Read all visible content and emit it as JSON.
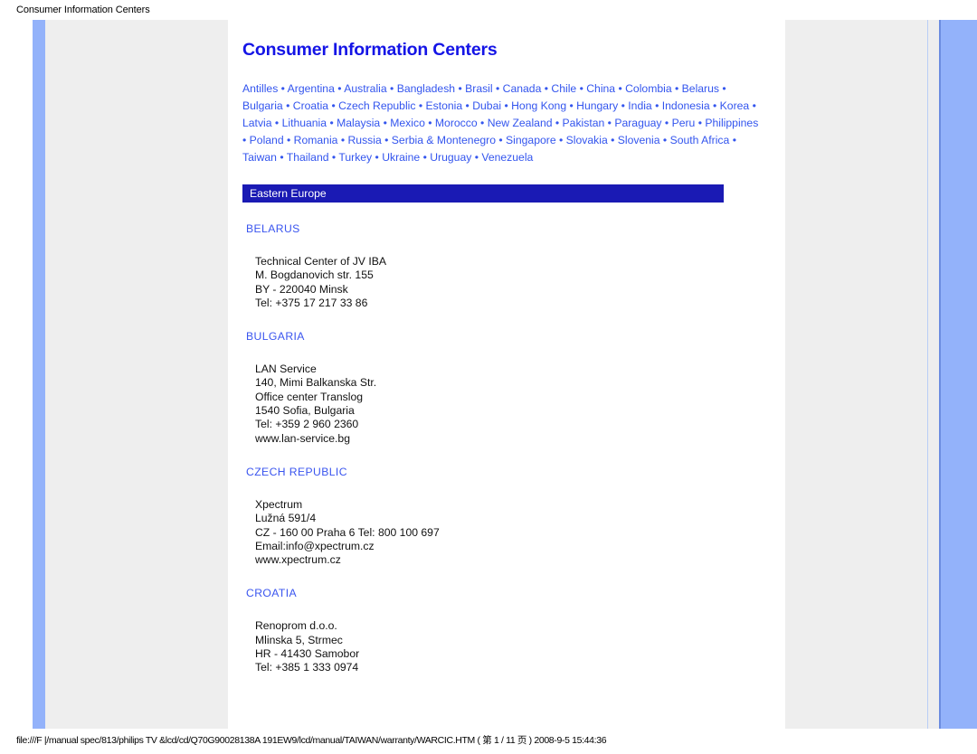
{
  "print_header": {
    "title": "Consumer Information Centers"
  },
  "print_footer": {
    "path": "file:///F |/manual spec/813/philips TV &lcd/cd/Q70G90028138A 191EW9/lcd/manual/TAIWAN/warranty/WARCIC.HTM ( 第 1 / 11 页 ) 2008-9-5 15:44:36"
  },
  "document": {
    "title": "Consumer Information Centers",
    "country_links": [
      "Antilles",
      "Argentina",
      "Australia",
      "Bangladesh",
      "Brasil",
      "Canada",
      "Chile",
      "China",
      "Colombia",
      "Belarus",
      "Bulgaria",
      "Croatia",
      "Czech Republic",
      "Estonia",
      "Dubai",
      "Hong Kong",
      "Hungary",
      "India",
      "Indonesia",
      "Korea",
      "Latvia",
      "Lithuania",
      "Malaysia",
      "Mexico",
      "Morocco",
      "New Zealand",
      "Pakistan",
      "Paraguay",
      "Peru",
      "Philippines",
      "Poland",
      "Romania",
      "Russia",
      "Serbia & Montenegro",
      "Singapore",
      "Slovakia",
      "Slovenia",
      "South Africa",
      "Taiwan",
      "Thailand",
      "Turkey",
      "Ukraine",
      "Uruguay",
      "Venezuela"
    ],
    "link_separator": "•",
    "region_banner": "Eastern Europe",
    "countries": [
      {
        "name": "BELARUS",
        "address": [
          "Technical Center of JV IBA",
          "M. Bogdanovich str. 155",
          "BY - 220040 Minsk",
          "Tel: +375 17 217 33 86"
        ]
      },
      {
        "name": "BULGARIA",
        "address": [
          "LAN Service",
          "140, Mimi Balkanska Str.",
          "Office center Translog",
          "1540 Sofia, Bulgaria",
          "Tel: +359 2 960 2360",
          "www.lan-service.bg"
        ]
      },
      {
        "name": "CZECH REPUBLIC",
        "address": [
          "Xpectrum",
          "Lužná 591/4",
          "CZ - 160 00 Praha 6 Tel: 800 100 697",
          "Email:info@xpectrum.cz",
          "www.xpectrum.cz"
        ]
      },
      {
        "name": "CROATIA",
        "address": [
          "Renoprom d.o.o.",
          "Mlinska 5, Strmec",
          "HR - 41430 Samobor",
          "Tel: +385 1 333 0974"
        ]
      }
    ]
  },
  "colors": {
    "link_blue": "#3355ee",
    "title_blue": "#1414e6",
    "banner_blue": "#1a1ab4",
    "frame_blue": "#93b2fa",
    "panel_gray": "#eeeeee"
  }
}
